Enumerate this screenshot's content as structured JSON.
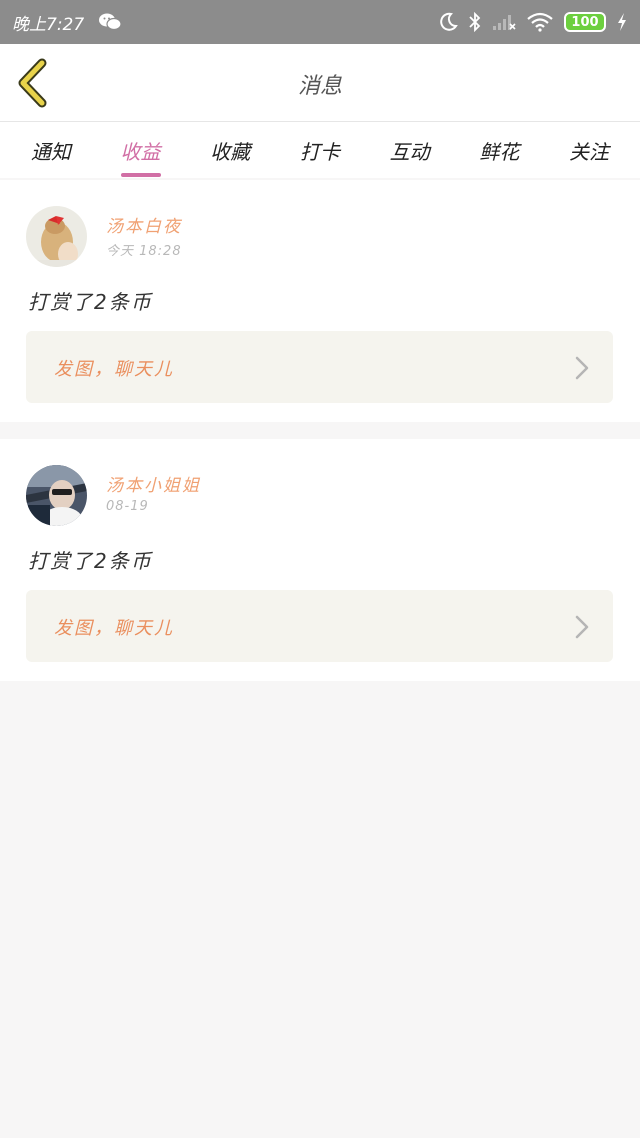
{
  "statusbar": {
    "time": "晚上7:27",
    "battery": "100"
  },
  "header": {
    "title": "消息"
  },
  "tabs": [
    {
      "label": "通知",
      "active": false
    },
    {
      "label": "收益",
      "active": true
    },
    {
      "label": "收藏",
      "active": false
    },
    {
      "label": "打卡",
      "active": false
    },
    {
      "label": "互动",
      "active": false
    },
    {
      "label": "鲜花",
      "active": false
    },
    {
      "label": "关注",
      "active": false
    }
  ],
  "messages": [
    {
      "username": "汤本白夜",
      "time": "今天 18:28",
      "text": "打赏了2条币",
      "cta": "发图，聊天儿"
    },
    {
      "username": "汤本小姐姐",
      "time": "08-19",
      "text": "打赏了2条币",
      "cta": "发图，聊天儿"
    }
  ],
  "colors": {
    "accent": "#d16fa5",
    "username": "#f0a173",
    "cta_text": "#ea8f5e",
    "back_icon": "#e8d34a"
  }
}
